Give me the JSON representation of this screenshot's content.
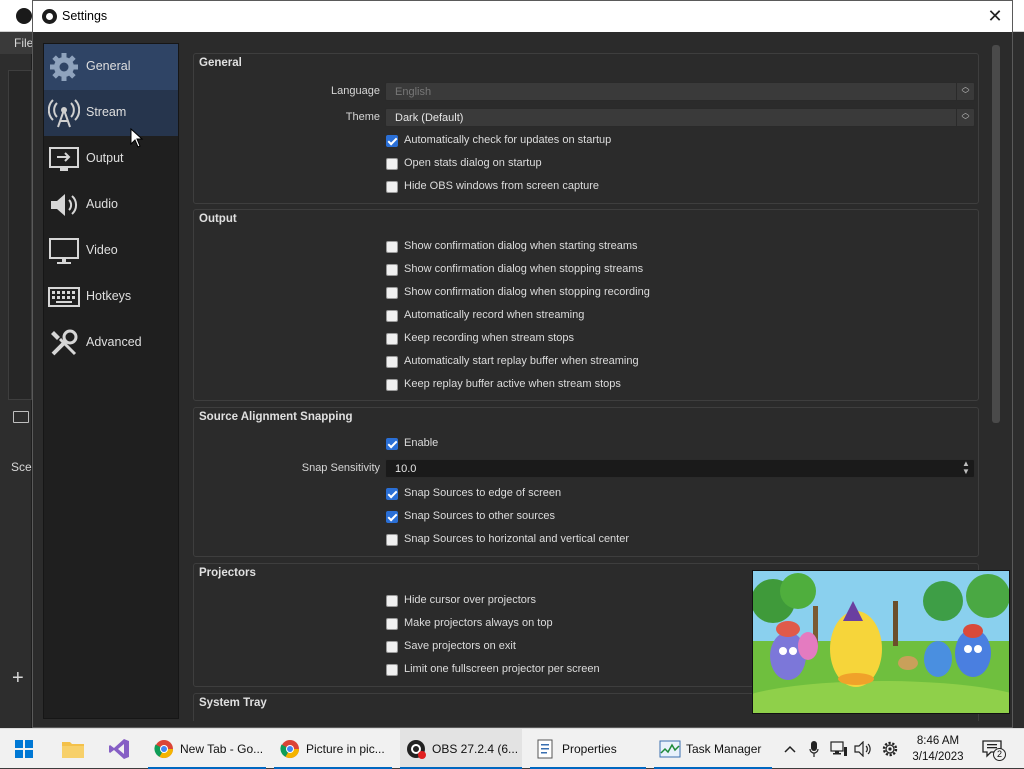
{
  "background_window": {
    "menu_label": "File",
    "scenes_label": "Scen"
  },
  "dialog": {
    "title": "Settings",
    "close_glyph": "✕"
  },
  "sidebar": {
    "items": [
      {
        "label": "General",
        "icon": "gear-icon",
        "state": "selected"
      },
      {
        "label": "Stream",
        "icon": "antenna-icon",
        "state": "hover"
      },
      {
        "label": "Output",
        "icon": "output-icon",
        "state": "normal"
      },
      {
        "label": "Audio",
        "icon": "speaker-icon",
        "state": "normal"
      },
      {
        "label": "Video",
        "icon": "monitor-icon",
        "state": "normal"
      },
      {
        "label": "Hotkeys",
        "icon": "keyboard-icon",
        "state": "normal"
      },
      {
        "label": "Advanced",
        "icon": "tools-icon",
        "state": "normal"
      }
    ]
  },
  "general": {
    "title": "General",
    "language_label": "Language",
    "language_value": "English",
    "theme_label": "Theme",
    "theme_value": "Dark (Default)",
    "checkboxes": [
      {
        "label": "Automatically check for updates on startup",
        "checked": true
      },
      {
        "label": "Open stats dialog on startup",
        "checked": false
      },
      {
        "label": "Hide OBS windows from screen capture",
        "checked": false
      }
    ]
  },
  "output": {
    "title": "Output",
    "checkboxes": [
      {
        "label": "Show confirmation dialog when starting streams",
        "checked": false
      },
      {
        "label": "Show confirmation dialog when stopping streams",
        "checked": false
      },
      {
        "label": "Show confirmation dialog when stopping recording",
        "checked": false
      },
      {
        "label": "Automatically record when streaming",
        "checked": false
      },
      {
        "label": "Keep recording when stream stops",
        "checked": false
      },
      {
        "label": "Automatically start replay buffer when streaming",
        "checked": false
      },
      {
        "label": "Keep replay buffer active when stream stops",
        "checked": false
      }
    ]
  },
  "snapping": {
    "title": "Source Alignment Snapping",
    "enable_label": "Enable",
    "enable_checked": true,
    "sensitivity_label": "Snap Sensitivity",
    "sensitivity_value": "10.0",
    "checkboxes": [
      {
        "label": "Snap Sources to edge of screen",
        "checked": true
      },
      {
        "label": "Snap Sources to other sources",
        "checked": true
      },
      {
        "label": "Snap Sources to horizontal and vertical center",
        "checked": false
      }
    ]
  },
  "projectors": {
    "title": "Projectors",
    "checkboxes": [
      {
        "label": "Hide cursor over projectors",
        "checked": false
      },
      {
        "label": "Make projectors always on top",
        "checked": false
      },
      {
        "label": "Save projectors on exit",
        "checked": false
      },
      {
        "label": "Limit one fullscreen projector per screen",
        "checked": false
      }
    ]
  },
  "system_tray": {
    "title": "System Tray"
  },
  "taskbar": {
    "apps": [
      {
        "label": "New Tab - Go...",
        "icon": "chrome-icon"
      },
      {
        "label": "Picture in pic...",
        "icon": "chrome-icon"
      },
      {
        "label": "OBS 27.2.4 (6...",
        "icon": "obs-icon"
      },
      {
        "label": "Properties",
        "icon": "properties-icon"
      },
      {
        "label": "Task Manager",
        "icon": "task-manager-icon"
      }
    ],
    "time": "8:46 AM",
    "date": "3/14/2023",
    "notification_count": "2"
  },
  "colors": {
    "selected_sidebar": "#2f4465",
    "checkbox_checked": "#2a6fd6",
    "dialog_bg": "#2b2b2b",
    "sidebar_bg": "#1f1f1f"
  }
}
